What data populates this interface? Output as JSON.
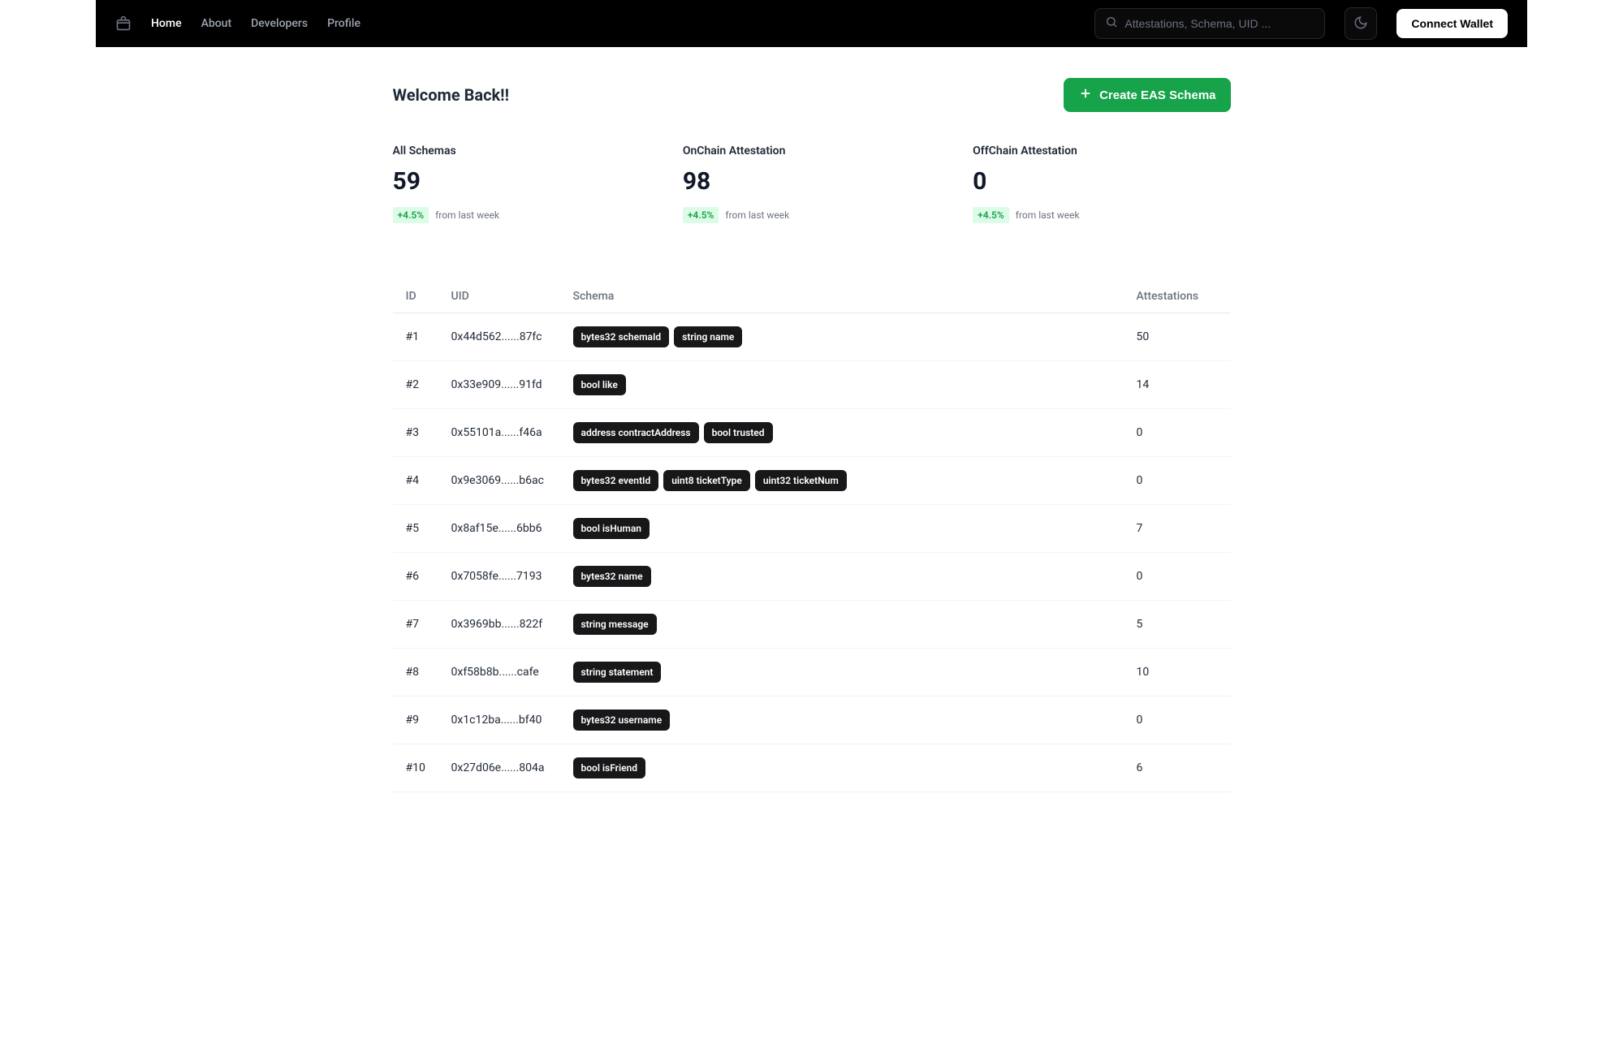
{
  "nav": {
    "items": [
      {
        "label": "Home",
        "active": true
      },
      {
        "label": "About",
        "active": false
      },
      {
        "label": "Developers",
        "active": false
      },
      {
        "label": "Profile",
        "active": false
      }
    ]
  },
  "search": {
    "placeholder": "Attestations, Schema, UID ..."
  },
  "connect_label": "Connect Wallet",
  "welcome": "Welcome Back!!",
  "create_schema_label": "Create EAS Schema",
  "stats": [
    {
      "label": "All Schemas",
      "value": "59",
      "change": "+4.5%",
      "sub": "from last week"
    },
    {
      "label": "OnChain Attestation",
      "value": "98",
      "change": "+4.5%",
      "sub": "from last week"
    },
    {
      "label": "OffChain Attestation",
      "value": "0",
      "change": "+4.5%",
      "sub": "from last week"
    }
  ],
  "table": {
    "headers": {
      "id": "ID",
      "uid": "UID",
      "schema": "Schema",
      "attestations": "Attestations"
    },
    "rows": [
      {
        "id": "#1",
        "uid": "0x44d562......87fc",
        "schema": [
          "bytes32 schemaId",
          "string name"
        ],
        "attestations": "50"
      },
      {
        "id": "#2",
        "uid": "0x33e909......91fd",
        "schema": [
          "bool like"
        ],
        "attestations": "14"
      },
      {
        "id": "#3",
        "uid": "0x55101a......f46a",
        "schema": [
          "address contractAddress",
          "bool trusted"
        ],
        "attestations": "0"
      },
      {
        "id": "#4",
        "uid": "0x9e3069......b6ac",
        "schema": [
          "bytes32 eventId",
          "uint8 ticketType",
          "uint32 ticketNum"
        ],
        "attestations": "0"
      },
      {
        "id": "#5",
        "uid": "0x8af15e......6bb6",
        "schema": [
          "bool isHuman"
        ],
        "attestations": "7"
      },
      {
        "id": "#6",
        "uid": "0x7058fe......7193",
        "schema": [
          "bytes32 name"
        ],
        "attestations": "0"
      },
      {
        "id": "#7",
        "uid": "0x3969bb......822f",
        "schema": [
          "string message"
        ],
        "attestations": "5"
      },
      {
        "id": "#8",
        "uid": "0xf58b8b......cafe",
        "schema": [
          "string statement"
        ],
        "attestations": "10"
      },
      {
        "id": "#9",
        "uid": "0x1c12ba......bf40",
        "schema": [
          "bytes32 username"
        ],
        "attestations": "0"
      },
      {
        "id": "#10",
        "uid": "0x27d06e......804a",
        "schema": [
          "bool isFriend"
        ],
        "attestations": "6"
      }
    ]
  }
}
